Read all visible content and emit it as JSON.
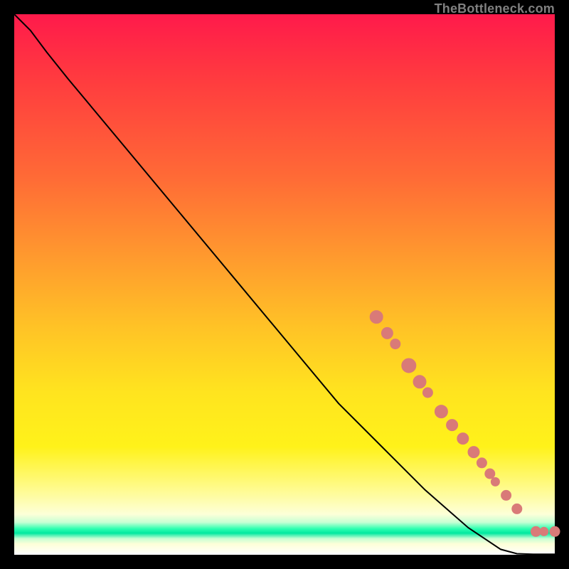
{
  "watermark": "TheBottleneck.com",
  "colors": {
    "marker": "#d97a78",
    "curve": "#000000"
  },
  "chart_data": {
    "type": "line",
    "title": "",
    "xlabel": "",
    "ylabel": "",
    "xlim": [
      0,
      100
    ],
    "ylim": [
      0,
      100
    ],
    "grid": false,
    "legend": false,
    "series": [
      {
        "name": "curve",
        "x": [
          0,
          3,
          6,
          10,
          20,
          30,
          40,
          50,
          60,
          68,
          76,
          84,
          90,
          93,
          96,
          100
        ],
        "y": [
          100,
          97,
          93,
          88,
          76,
          64,
          52,
          40,
          28,
          20,
          12,
          5,
          1,
          0.2,
          0.1,
          0.1
        ]
      }
    ],
    "markers": [
      {
        "x": 67,
        "y": 44,
        "r": 9
      },
      {
        "x": 69,
        "y": 41,
        "r": 8
      },
      {
        "x": 70.5,
        "y": 39,
        "r": 7
      },
      {
        "x": 73,
        "y": 35,
        "r": 10
      },
      {
        "x": 75,
        "y": 32,
        "r": 9
      },
      {
        "x": 76.5,
        "y": 30,
        "r": 7
      },
      {
        "x": 79,
        "y": 26.5,
        "r": 9
      },
      {
        "x": 81,
        "y": 24,
        "r": 8
      },
      {
        "x": 83,
        "y": 21.5,
        "r": 8
      },
      {
        "x": 85,
        "y": 19,
        "r": 8
      },
      {
        "x": 86.5,
        "y": 17,
        "r": 7
      },
      {
        "x": 88,
        "y": 15,
        "r": 7
      },
      {
        "x": 89,
        "y": 13.5,
        "r": 6
      },
      {
        "x": 91,
        "y": 11,
        "r": 7
      },
      {
        "x": 93,
        "y": 8.5,
        "r": 7
      },
      {
        "x": 96.5,
        "y": 4.3,
        "r": 7
      },
      {
        "x": 98,
        "y": 4.3,
        "r": 6
      },
      {
        "x": 100,
        "y": 4.3,
        "r": 7
      }
    ]
  }
}
